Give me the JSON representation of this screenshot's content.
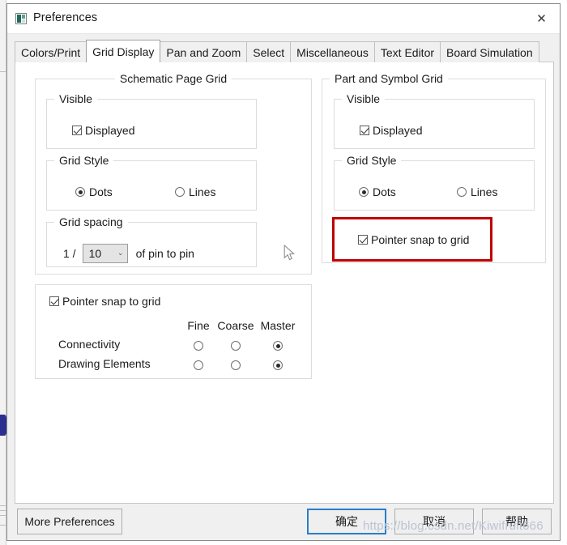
{
  "window": {
    "title": "Preferences",
    "icon": "preferences-app-icon",
    "close_label": "✕"
  },
  "tabs": [
    {
      "label": "Colors/Print",
      "active": false
    },
    {
      "label": "Grid Display",
      "active": true
    },
    {
      "label": "Pan and Zoom",
      "active": false
    },
    {
      "label": "Select",
      "active": false
    },
    {
      "label": "Miscellaneous",
      "active": false
    },
    {
      "label": "Text Editor",
      "active": false
    },
    {
      "label": "Board Simulation",
      "active": false
    }
  ],
  "schematic_page_grid": {
    "legend": "Schematic Page Grid",
    "visible": {
      "legend": "Visible",
      "displayed_label": "Displayed",
      "displayed_checked": true
    },
    "grid_style": {
      "legend": "Grid Style",
      "dots_label": "Dots",
      "dots_selected": true,
      "lines_label": "Lines",
      "lines_selected": false
    },
    "grid_spacing": {
      "legend": "Grid spacing",
      "prefix": "1 /",
      "value": "10",
      "chevron": "⌄",
      "suffix": "of pin to pin"
    }
  },
  "schematic_snap": {
    "checkbox_label": "Pointer snap to grid",
    "checkbox_checked": true,
    "columns": [
      "Fine",
      "Coarse",
      "Master"
    ],
    "rows": [
      {
        "label": "Connectivity",
        "selected": "Master"
      },
      {
        "label": "Drawing Elements",
        "selected": "Master"
      }
    ]
  },
  "part_symbol_grid": {
    "legend": "Part and Symbol Grid",
    "visible": {
      "legend": "Visible",
      "displayed_label": "Displayed",
      "displayed_checked": true
    },
    "grid_style": {
      "legend": "Grid Style",
      "dots_label": "Dots",
      "dots_selected": true,
      "lines_label": "Lines",
      "lines_selected": false
    },
    "snap": {
      "label": "Pointer snap to grid",
      "checked": true,
      "highlighted": true,
      "highlight_color": "#c00000"
    }
  },
  "footer": {
    "more_preferences": "More Preferences",
    "ok": "确定",
    "cancel": "取消",
    "help": "帮助",
    "default_button": "ok",
    "focus_color": "#2a7ec8"
  },
  "overlay": {
    "watermark": "https://blog.csdn.net/Kiwifruit666",
    "cursor": "mouse-arrow-cursor"
  }
}
